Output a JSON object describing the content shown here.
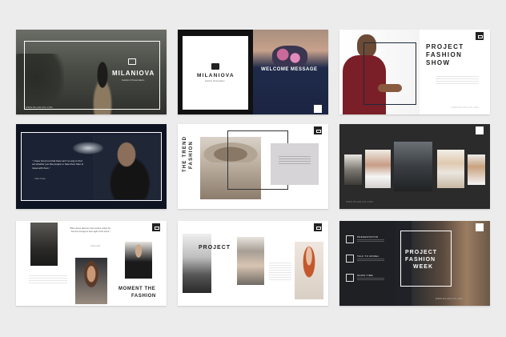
{
  "slide1": {
    "title": "MILANIOVA",
    "subtitle": "Fashion Presentation",
    "footer": "WWW.MILANIOVA.COM"
  },
  "slide2": {
    "brand": "MILANIOVA",
    "brand_sub": "Fashion Presentation",
    "welcome": "WELCOME MESSAGE"
  },
  "slide3": {
    "title_line1": "PROJECT",
    "title_line2": "FASHION",
    "title_line3": "SHOW",
    "footer": "WWW.MILANIOVA.COM"
  },
  "slide4": {
    "quote": "\" I have found out that there ain't no way to find out whether you like people or hate them than to travel with them.\"",
    "author": "- Mark Twain"
  },
  "slide5": {
    "vertical_title_line1": "THE TREND",
    "vertical_title_line2": "FASHION"
  },
  "slide6": {
    "footer": "WWW.MILANIOVA.COM"
  },
  "slide7": {
    "quote": "\"Man cannot discover new oceans unless he has the courage to lose sight of the shore.\"",
    "author": "- Andre Gide",
    "title_line1": "MOMENT THE",
    "title_line2": "FASHION"
  },
  "slide8": {
    "title": "PROJECT"
  },
  "slide9": {
    "items": [
      {
        "label": "PRESENTATION",
        "icon": "monitor-icon"
      },
      {
        "label": "TALK TO MODEL",
        "icon": "chat-icon"
      },
      {
        "label": "SHOW TIME",
        "icon": "camera-icon"
      }
    ],
    "title_line1": "PROJECT",
    "title_line2": "FASHION",
    "title_line3": "WEEK",
    "footer": "WWW.MILANIOVA.COM"
  },
  "colors": {
    "background": "#ececec",
    "dark": "#222222",
    "slide_dark": "#2b2b2b",
    "navy": "#1d2433"
  }
}
